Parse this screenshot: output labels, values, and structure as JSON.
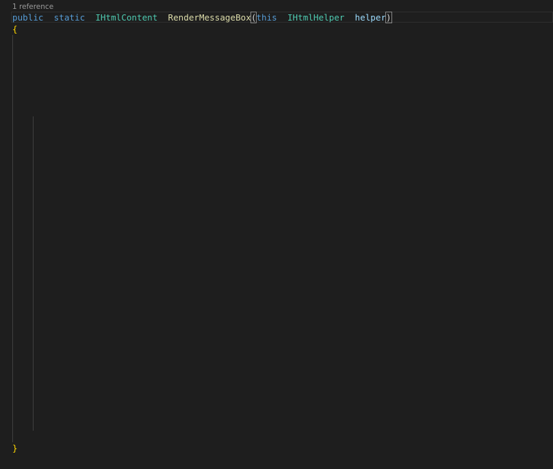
{
  "editor": {
    "codelens": "1 reference",
    "lines": [
      [
        [
          "kw",
          "public"
        ],
        [
          "",
          "  "
        ],
        [
          "kw",
          "static"
        ],
        [
          "",
          "  "
        ],
        [
          "type",
          "IHtmlContent"
        ],
        [
          "",
          "  "
        ],
        [
          "fn",
          "RenderMessageBox"
        ],
        [
          "bm",
          "("
        ],
        [
          "kw",
          "this"
        ],
        [
          "",
          "  "
        ],
        [
          "type",
          "IHtmlHelper"
        ],
        [
          "",
          "  "
        ],
        [
          "var",
          "helper"
        ],
        [
          "bm",
          ")"
        ]
      ],
      [
        [
          "br",
          "{"
        ]
      ],
      [],
      [],
      [],
      [],
      [],
      [],
      [],
      [],
      [],
      [],
      [],
      [],
      [],
      [],
      [],
      [],
      [],
      [],
      [],
      [],
      [],
      [],
      [],
      [],
      [],
      [],
      [],
      [],
      [],
      [],
      [],
      [],
      [],
      [],
      [],
      [
        [
          "br",
          "}"
        ]
      ]
    ]
  }
}
